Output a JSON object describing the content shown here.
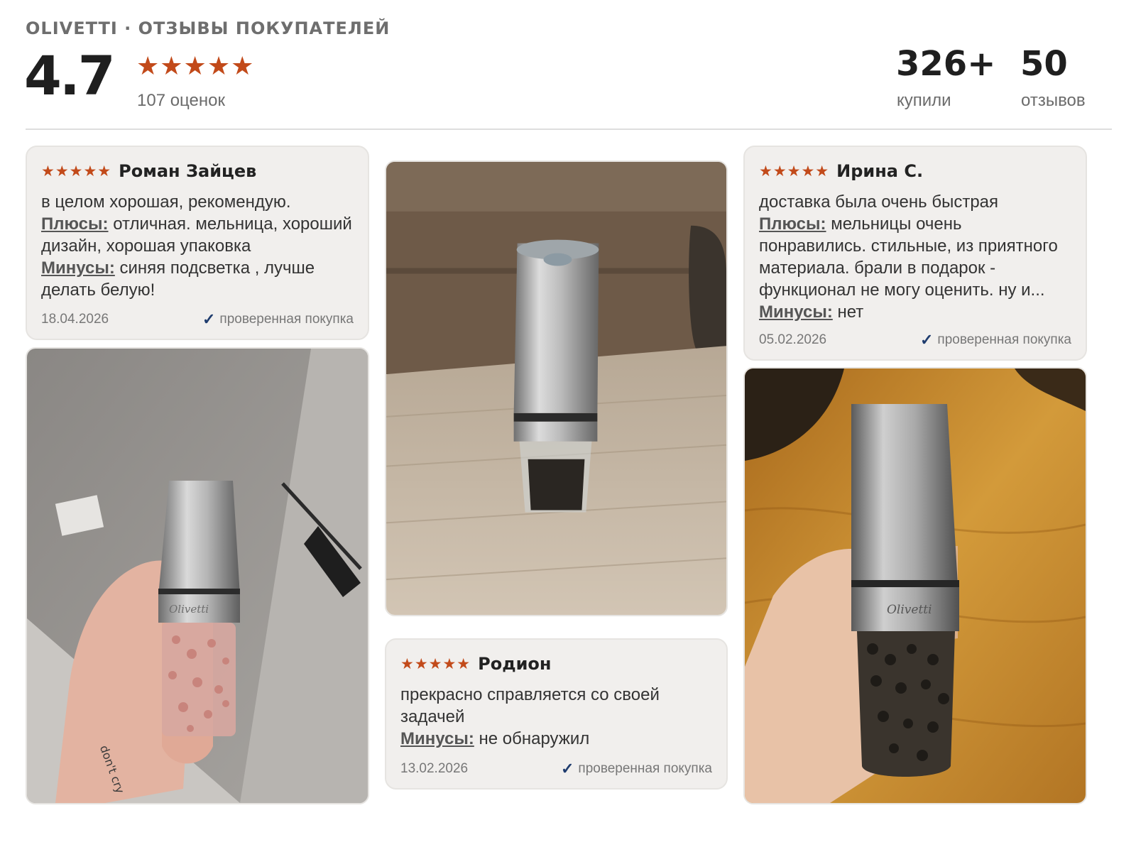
{
  "header": {
    "brand": "OLIVETTI · ОТЗЫВЫ ПОКУПАТЕЛЕЙ",
    "rating": "4.7",
    "stars": "★★★★★",
    "ratings_count": "107 оценок",
    "stats": [
      {
        "value": "326+",
        "label": "купили"
      },
      {
        "value": "50",
        "label": "отзывов"
      }
    ]
  },
  "reviews": [
    {
      "stars": "★★★★★",
      "author": "Роман Зайцев",
      "text": "в целом хорошая, рекомендую.",
      "pros_label": "Плюсы:",
      "pros": "отличная. мельница, хороший дизайн, хорошая упаковка",
      "cons_label": "Минусы:",
      "cons": "синяя подсветка , лучше делать белую!",
      "date": "18.04.2026",
      "verified": "проверенная покупка"
    },
    {
      "stars": "★★★★★",
      "author": "Родион",
      "text": "прекрасно справляется со своей задачей",
      "cons_label": "Минусы:",
      "cons": "не обнаружил",
      "date": "13.02.2026",
      "verified": "проверенная покупка"
    },
    {
      "stars": "★★★★★",
      "author": "Ирина С.",
      "text": "доставка была очень быстрая",
      "pros_label": "Плюсы:",
      "pros": "мельницы очень понравились. стильные, из приятного материала. брали в подарок - функционал не могу оценить. ну и...",
      "cons_label": "Минусы:",
      "cons": "нет",
      "date": "05.02.2026",
      "verified": "проверенная покупка"
    }
  ],
  "photos": {
    "pink_salt_logo": "Olivetti",
    "pepper_logo": "Olivetti",
    "tattoo": "don't cry"
  },
  "colors": {
    "star": "#c24a1a",
    "card_bg": "#f1efed",
    "check": "#1f3c6e"
  }
}
